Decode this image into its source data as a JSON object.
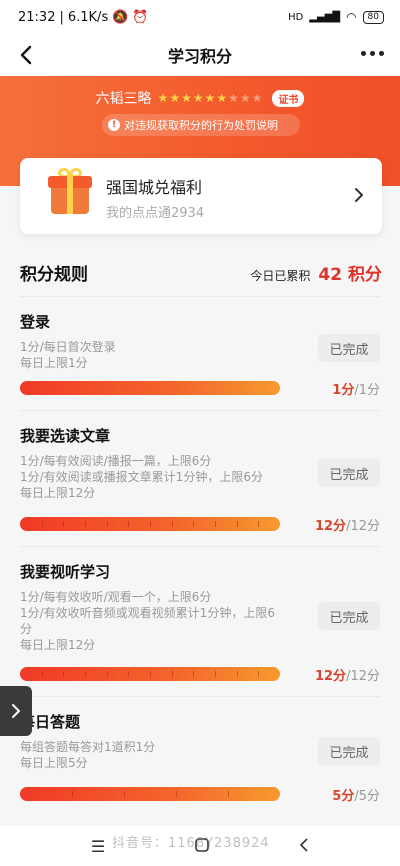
{
  "status_bar": {
    "time": "21:32",
    "speed": "6.1K/s",
    "network": "HD",
    "battery": "80"
  },
  "nav": {
    "title": "学习积分"
  },
  "banner": {
    "rank_name": "六韬三略",
    "stars_total": 9,
    "stars_filled": 6,
    "cert_label": "证书",
    "notice": "对违规获取积分的行为处罚说明"
  },
  "welfare": {
    "title": "强国城兑福利",
    "subtitle": "我的点点通2934"
  },
  "rules": {
    "title": "积分规则",
    "today_label": "今日已累积",
    "today_value": "42 积分",
    "items": [
      {
        "title": "登录",
        "desc": [
          "1分/每日首次登录",
          "每日上限1分"
        ],
        "button": "已完成",
        "earned": "1分",
        "max": "/1分",
        "progress": 1.0,
        "segments": 1
      },
      {
        "title": "我要选读文章",
        "desc": [
          "1分/每有效阅读/播报一篇，上限6分",
          "1分/有效阅读或播报文章累计1分钟，上限6分",
          "每日上限12分"
        ],
        "button": "已完成",
        "earned": "12分",
        "max": "/12分",
        "progress": 1.0,
        "segments": 12
      },
      {
        "title": "我要视听学习",
        "desc": [
          "1分/每有效收听/观看一个，上限6分",
          "1分/有效收听音频或观看视频累计1分钟，上限6",
          "分",
          "每日上限12分"
        ],
        "button": "已完成",
        "earned": "12分",
        "max": "/12分",
        "progress": 1.0,
        "segments": 12
      },
      {
        "title": "每日答题",
        "desc": [
          "每组答题每答对1道积1分",
          "每日上限5分"
        ],
        "button": "已完成",
        "earned": "5分",
        "max": "/5分",
        "progress": 1.0,
        "segments": 5
      }
    ]
  },
  "watermark": "抖音号：1168Y238924",
  "colors": {
    "accent": "#f35a2c",
    "score_red": "#e0322a"
  }
}
